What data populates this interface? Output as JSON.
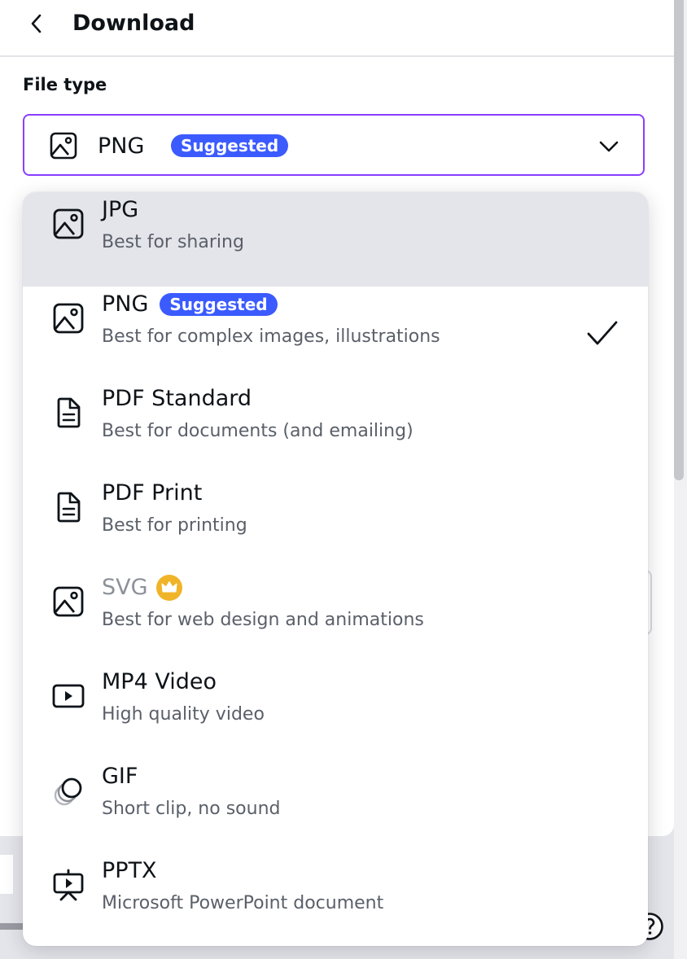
{
  "header": {
    "title": "Download"
  },
  "file_type": {
    "label": "File type",
    "selected": "PNG",
    "selected_badge": "Suggested"
  },
  "options": [
    {
      "title": "JPG",
      "description": "Best for sharing",
      "icon": "image-icon"
    },
    {
      "title": "PNG",
      "badge": "Suggested",
      "description": "Best for complex images, illustrations",
      "icon": "image-icon",
      "selected": true
    },
    {
      "title": "PDF Standard",
      "description": "Best for documents (and emailing)",
      "icon": "document-icon"
    },
    {
      "title": "PDF Print",
      "description": "Best for printing",
      "icon": "document-icon"
    },
    {
      "title": "SVG",
      "description": "Best for web design and animations",
      "icon": "image-icon",
      "premium": true
    },
    {
      "title": "MP4 Video",
      "description": "High quality video",
      "icon": "video-icon"
    },
    {
      "title": "GIF",
      "description": "Short clip, no sound",
      "icon": "gif-icon"
    },
    {
      "title": "PPTX",
      "description": "Microsoft PowerPoint document",
      "icon": "presentation-icon"
    }
  ],
  "colors": {
    "accent_border": "#8b3dff",
    "badge": "#3b5bff",
    "highlight_row": "#e4e5ea",
    "crown": "#f0b429"
  }
}
